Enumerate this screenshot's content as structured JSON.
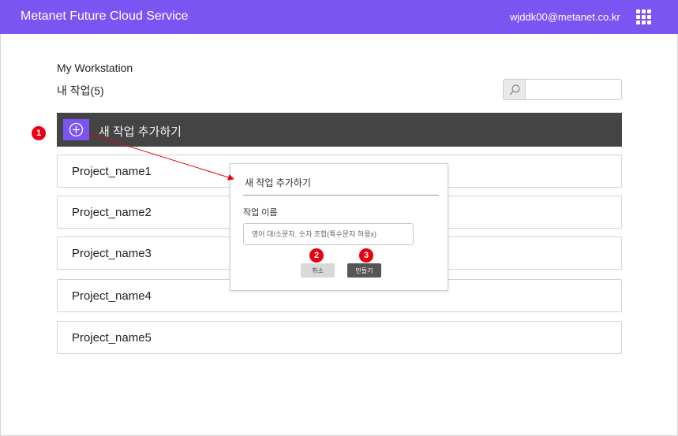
{
  "header": {
    "brand": "Metanet Future Cloud Service",
    "user_email": "wjddk00@metanet.co.kr",
    "apps_icon": "grid-menu-icon",
    "color": "#7b55f2"
  },
  "workspace": {
    "title": "My Workstation",
    "subtitle": "내 작업(5)"
  },
  "search": {
    "icon": "search-icon",
    "placeholder": "",
    "value": ""
  },
  "add_bar": {
    "label": "새 작업 추가하기",
    "icon": "plus-circle-icon",
    "color": "#444444"
  },
  "projects": [
    {
      "name": "Project_name1"
    },
    {
      "name": "Project_name2"
    },
    {
      "name": "Project_name3"
    },
    {
      "name": "Project_name4"
    },
    {
      "name": "Project_name5"
    }
  ],
  "dialog": {
    "title": "새 작업 추가하기",
    "field_label": "작업 이름",
    "input_placeholder": "영어 대/소문자, 숫자 조합(특수문자 허용x)",
    "cancel_label": "취소",
    "create_label": "만들기"
  },
  "annotations": {
    "badge_color": "#e60012",
    "step1": "1",
    "step2": "2",
    "step3": "3"
  }
}
